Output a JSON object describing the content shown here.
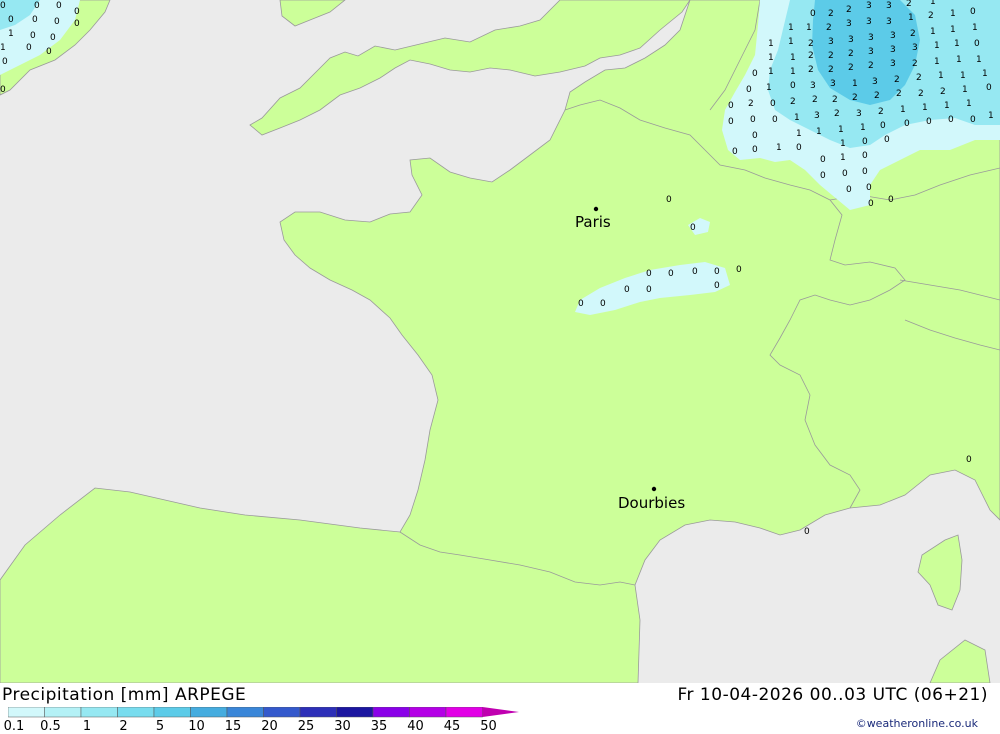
{
  "map": {
    "cities": [
      {
        "name": "Paris"
      },
      {
        "name": "Dourbies"
      }
    ]
  },
  "footer": {
    "title": "Precipitation [mm] ARPEGE",
    "datetime": "Fr 10-04-2026 00..03 UTC (06+21)",
    "credit": "©weatheronline.co.uk"
  },
  "legend": {
    "labels": [
      "0.1",
      "0.5",
      "1",
      "2",
      "5",
      "10",
      "15",
      "20",
      "25",
      "30",
      "35",
      "40",
      "45",
      "50"
    ],
    "colors": [
      "#d2f8fb",
      "#b4f1f6",
      "#96e8f2",
      "#78dcee",
      "#5ccbe8",
      "#45acdf",
      "#3a86d8",
      "#3459cc",
      "#2d2fb8",
      "#1c16a0",
      "#8a00e8",
      "#b400e6",
      "#e200e6",
      "#c000b0"
    ]
  },
  "colors": {
    "land": "#ccff99",
    "sea": "#ebebeb",
    "precip_light": "#d2f8fb",
    "precip_mid": "#96e8f2",
    "precip_heavy": "#5ccbe8"
  }
}
